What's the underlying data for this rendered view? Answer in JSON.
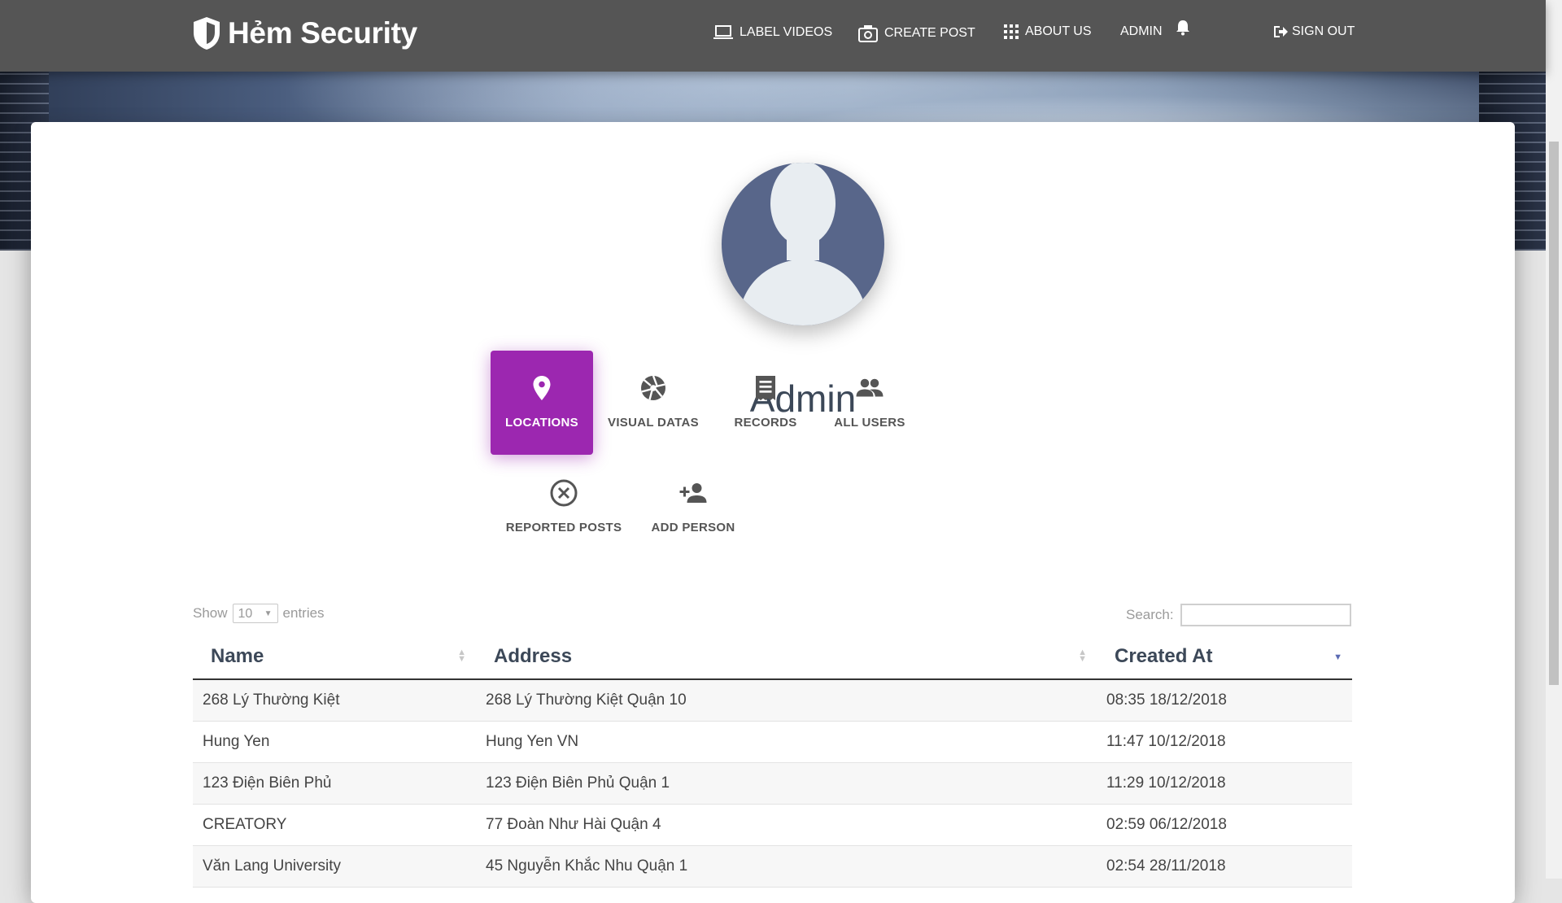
{
  "navbar": {
    "brand": "Hẻm Security",
    "items": [
      {
        "label": "LABEL VIDEOS",
        "icon": "laptop-icon"
      },
      {
        "label": "CREATE POST",
        "icon": "camera-icon"
      },
      {
        "label": "ABOUT US",
        "icon": "grid-icon"
      },
      {
        "label": "ADMIN",
        "icon": "bell-icon"
      },
      {
        "label": "SIGN OUT",
        "icon": "sign-out-icon"
      }
    ]
  },
  "profile": {
    "name": "Admin"
  },
  "tabs": [
    {
      "label": "LOCATIONS",
      "icon": "location-pin-icon",
      "active": true
    },
    {
      "label": "VISUAL DATAS",
      "icon": "camera-shutter-icon",
      "active": false
    },
    {
      "label": "RECORDS",
      "icon": "receipt-icon",
      "active": false
    },
    {
      "label": "ALL USERS",
      "icon": "people-icon",
      "active": false
    },
    {
      "label": "REPORTED POSTS",
      "icon": "x-circle-icon",
      "active": false
    },
    {
      "label": "ADD PERSON",
      "icon": "person-add-icon",
      "active": false
    }
  ],
  "table_controls": {
    "show_label": "Show",
    "entries_value": "10",
    "entries_label": "entries",
    "search_label": "Search:"
  },
  "table": {
    "headers": [
      "Name",
      "Address",
      "Created At"
    ],
    "rows": [
      [
        "268 Lý Thường Kiệt",
        "268 Lý Thường Kiệt Quận 10",
        "08:35 18/12/2018"
      ],
      [
        "Hung Yen",
        "Hung Yen VN",
        "11:47 10/12/2018"
      ],
      [
        "123 Điện Biên Phủ",
        "123 Điện Biên Phủ Quận 1",
        "11:29 10/12/2018"
      ],
      [
        "CREATORY",
        "77 Đoàn Như Hài Quận 4",
        "02:59 06/12/2018"
      ],
      [
        "Văn Lang University",
        "45 Nguyễn Khắc Nhu Quận 1",
        "02:54 28/11/2018"
      ]
    ]
  },
  "colors": {
    "accent": "#9c27b0",
    "navbar": "#555555"
  }
}
